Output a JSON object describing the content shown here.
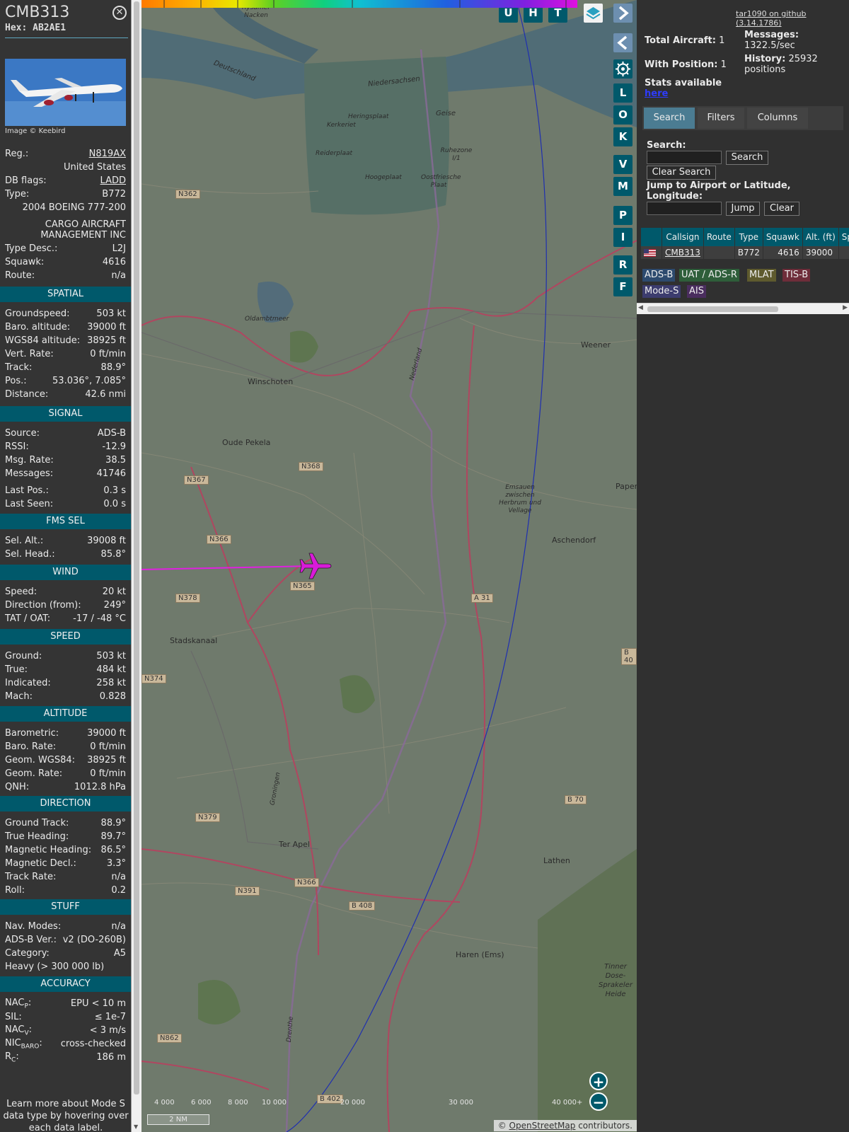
{
  "aircraft": {
    "callsign": "CMB313",
    "hex": "Hex: AB2AE1",
    "image_credit": "Image © Keebird",
    "info": [
      {
        "label": "Reg.:",
        "value": "N819AX"
      },
      {
        "label": "",
        "value": "United States"
      },
      {
        "label": "DB flags:",
        "value": "LADD"
      },
      {
        "label": "Type:",
        "value": "B772"
      },
      {
        "label": "",
        "value": "2004 BOEING 777-200"
      },
      {
        "label": "",
        "value": "CARGO AIRCRAFT MANAGEMENT INC"
      },
      {
        "label": "Type Desc.:",
        "value": "L2J"
      },
      {
        "label": "Squawk:",
        "value": "4616"
      },
      {
        "label": "Route:",
        "value": "n/a"
      }
    ]
  },
  "sections": [
    {
      "title": "SPATIAL",
      "rows": [
        {
          "label": "Groundspeed:",
          "value": "503 kt"
        },
        {
          "label": "Baro. altitude:",
          "value": "39000 ft"
        },
        {
          "label": "WGS84 altitude:",
          "value": "38925 ft"
        },
        {
          "label": "Vert. Rate:",
          "value": "0 ft/min"
        },
        {
          "label": "Track:",
          "value": "88.9°"
        },
        {
          "label": "Pos.:",
          "value": "53.036°, 7.085°"
        },
        {
          "label": "Distance:",
          "value": "42.6 nmi"
        }
      ]
    },
    {
      "title": "SIGNAL",
      "rows": [
        {
          "label": "Source:",
          "value": "ADS-B"
        },
        {
          "label": "RSSI:",
          "value": "-12.9"
        },
        {
          "label": "Msg. Rate:",
          "value": "38.5"
        },
        {
          "label": "Messages:",
          "value": "41746"
        },
        {
          "label": "Last Pos.:",
          "value": "0.3 s"
        },
        {
          "label": "Last Seen:",
          "value": "0.0 s"
        }
      ]
    },
    {
      "title": "FMS SEL",
      "rows": [
        {
          "label": "Sel. Alt.:",
          "value": "39008 ft"
        },
        {
          "label": "Sel. Head.:",
          "value": "85.8°"
        }
      ]
    },
    {
      "title": "WIND",
      "rows": [
        {
          "label": "Speed:",
          "value": "20 kt"
        },
        {
          "label": "Direction (from):",
          "value": "249°"
        },
        {
          "label": "TAT / OAT:",
          "value": "-17 / -48 °C"
        }
      ]
    },
    {
      "title": "SPEED",
      "rows": [
        {
          "label": "Ground:",
          "value": "503 kt"
        },
        {
          "label": "True:",
          "value": "484 kt"
        },
        {
          "label": "Indicated:",
          "value": "258 kt"
        },
        {
          "label": "Mach:",
          "value": "0.828"
        }
      ]
    },
    {
      "title": "ALTITUDE",
      "rows": [
        {
          "label": "Barometric:",
          "value": "39000 ft"
        },
        {
          "label": "Baro. Rate:",
          "value": "0 ft/min"
        },
        {
          "label": "Geom. WGS84:",
          "value": "38925 ft"
        },
        {
          "label": "Geom. Rate:",
          "value": "0 ft/min"
        },
        {
          "label": "QNH:",
          "value": "1012.8 hPa"
        }
      ]
    },
    {
      "title": "DIRECTION",
      "rows": [
        {
          "label": "Ground Track:",
          "value": "88.9°"
        },
        {
          "label": "True Heading:",
          "value": "89.7°"
        },
        {
          "label": "Magnetic Heading:",
          "value": "86.5°"
        },
        {
          "label": "Magnetic Decl.:",
          "value": "3.3°"
        },
        {
          "label": "Track Rate:",
          "value": "n/a"
        },
        {
          "label": "Roll:",
          "value": "0.2"
        }
      ]
    },
    {
      "title": "STUFF",
      "rows": [
        {
          "label": "Nav. Modes:",
          "value": "n/a"
        },
        {
          "label": "ADS-B Ver.:",
          "value": "v2 (DO-260B)"
        },
        {
          "label": "Category:",
          "value": "A5"
        },
        {
          "label": "Heavy (> 300 000 lb)",
          "value": ""
        }
      ]
    },
    {
      "title": "ACCURACY",
      "rows": [
        {
          "label": "NACP:",
          "value": "EPU < 10 m"
        },
        {
          "label": "SIL:",
          "value": "≤ 1e-7"
        },
        {
          "label": "NACV:",
          "value": "< 3 m/s"
        },
        {
          "label": "NICBARO:",
          "value": "cross-checked"
        },
        {
          "label": "RC:",
          "value": "186 m"
        }
      ]
    }
  ],
  "footer_note": "Learn more about Mode S data type by hovering over each data label.",
  "map": {
    "buttons": {
      "u": "U",
      "h": "H",
      "t": "T",
      "l": "L",
      "o": "O",
      "k": "K",
      "v": "V",
      "m": "M",
      "p": "P",
      "i": "I",
      "r": "R",
      "f": "F"
    },
    "place_labels": [
      "Rysumer Nacken",
      "Deutschland",
      "Niedersachsen",
      "Heringsplaat",
      "Geise",
      "Kerkeriet",
      "Reiderplaat",
      "Ruhezone I/1",
      "Hoogeplaat",
      "Oostfriesche Plaat",
      "Oldambtmeer",
      "Winschoten",
      "Weener",
      "Oude Pekela",
      "Emsauen zwischen Herbrum und Vellage",
      "Papenburg",
      "Aschendorf",
      "Stadskanaal",
      "Ter Apel",
      "Lathen",
      "Haren (Ems)",
      "Tinner Dose-Sprakeler Heide",
      "Nederland",
      "Groningen",
      "Drenthe"
    ],
    "road_labels": [
      "N362",
      "N367",
      "N368",
      "N366",
      "N365",
      "N378",
      "N374",
      "N379",
      "N391",
      "N366",
      "B 408",
      "B 70",
      "B 40",
      "A 31",
      "N862",
      "B 402"
    ],
    "legend_labels": [
      "4 000",
      "6 000",
      "8 000",
      "10 000",
      "20 000",
      "30 000",
      "40 000+"
    ],
    "scale": "2 NM",
    "attribution_prefix": "© ",
    "attribution_link": "OpenStreetMap",
    "attribution_suffix": " contributors."
  },
  "stats": {
    "github": "tar1090 on github (3.14.1786)",
    "total_label": "Total Aircraft:",
    "total": "1",
    "position_label": "With Position:",
    "position": "1",
    "messages_label": "Messages:",
    "messages": "1322.5/sec",
    "history_label": "History:",
    "history": "25932 positions",
    "stats_label": "Stats available",
    "stats_link": "here"
  },
  "tabs": [
    "Search",
    "Filters",
    "Columns"
  ],
  "search": {
    "label": "Search:",
    "button": "Search",
    "clear": "Clear Search",
    "jump_label": "Jump to Airport or Latitude, Longitude:",
    "jump_button": "Jump",
    "jump_clear": "Clear"
  },
  "table": {
    "headers": [
      "",
      "Callsign",
      "Route",
      "Type",
      "Squawk",
      "Alt. (ft)",
      "Spd."
    ],
    "rows": [
      {
        "callsign": "CMB313",
        "route": "",
        "type": "B772",
        "squawk": "4616",
        "alt": "39000",
        "spd": ""
      }
    ]
  },
  "sources": [
    {
      "label": "ADS-B",
      "color": "#2d4a6e"
    },
    {
      "label": "UAT / ADS-R",
      "color": "#2e5e3a"
    },
    {
      "label": "MLAT",
      "color": "#5e5a2e"
    },
    {
      "label": "TIS-B",
      "color": "#6e2d3a"
    },
    {
      "label": "Mode-S",
      "color": "#3c3c6e"
    },
    {
      "label": "AIS",
      "color": "#4a2d5e"
    }
  ],
  "colors": {
    "accent": "#00596b",
    "track": "#e020e0",
    "aircraft": "#d81bd8"
  }
}
